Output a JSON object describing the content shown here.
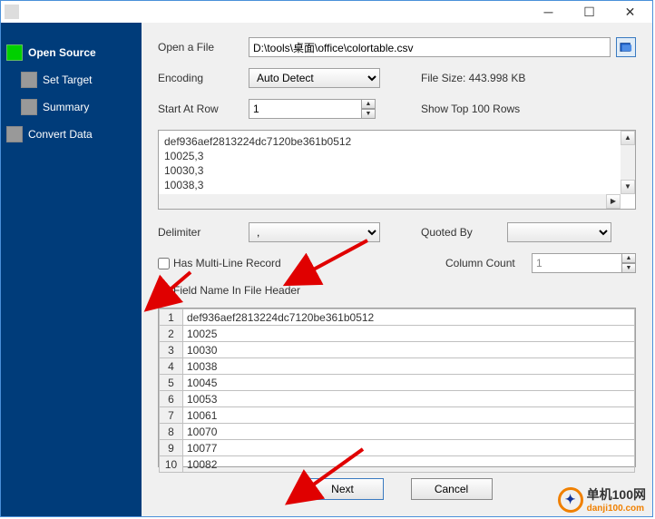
{
  "sidebar": {
    "items": [
      {
        "label": "Open Source",
        "active": true,
        "indent": 0
      },
      {
        "label": "Set Target",
        "active": false,
        "indent": 1
      },
      {
        "label": "Summary",
        "active": false,
        "indent": 1
      },
      {
        "label": "Convert Data",
        "active": false,
        "indent": 0
      }
    ]
  },
  "open_file_label": "Open a File",
  "file_path": "D:\\tools\\桌面\\office\\colortable.csv",
  "encoding_label": "Encoding",
  "encoding_value": "Auto Detect",
  "file_size_label": "File Size: 443.998 KB",
  "start_row_label": "Start At Row",
  "start_row_value": "1",
  "show_top_label": "Show Top 100 Rows",
  "preview_lines": [
    "def936aef2813224dc7120be361b0512",
    "10025,3",
    "10030,3",
    "10038,3"
  ],
  "delimiter_label": "Delimiter",
  "delimiter_value": ",",
  "quoted_label": "Quoted By",
  "quoted_value": " ",
  "multiline_label": "Has Multi-Line Record",
  "column_count_label": "Column Count",
  "column_count_value": "1",
  "fieldname_label": "Field Name In File Header",
  "table_rows": [
    {
      "n": "1",
      "v": "def936aef2813224dc7120be361b0512"
    },
    {
      "n": "2",
      "v": "10025"
    },
    {
      "n": "3",
      "v": "10030"
    },
    {
      "n": "4",
      "v": "10038"
    },
    {
      "n": "5",
      "v": "10045"
    },
    {
      "n": "6",
      "v": "10053"
    },
    {
      "n": "7",
      "v": "10061"
    },
    {
      "n": "8",
      "v": "10070"
    },
    {
      "n": "9",
      "v": "10077"
    },
    {
      "n": "10",
      "v": "10082"
    }
  ],
  "next_btn": "Next",
  "cancel_btn": "Cancel",
  "watermark_cn": "单机100网",
  "watermark_url": "danji100.com"
}
